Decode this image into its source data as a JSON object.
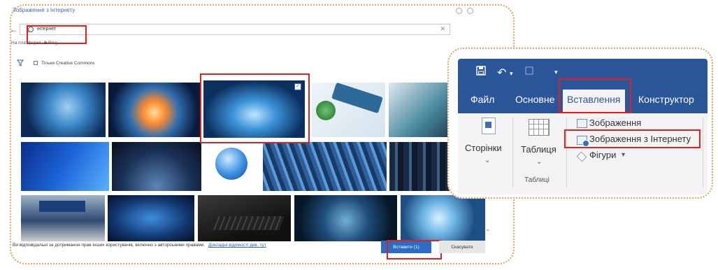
{
  "dialog": {
    "title": "Зображення з Інтернету",
    "search_value": "інтернет",
    "powered_by": "На платформі",
    "powered_brand": "Bing",
    "filter_label": "Тільки Creative Commons",
    "footer_text": "Ви відповідальні за дотримання прав інших користувачів, включно з авторськими правами.",
    "footer_link": "Докладні відомості див. тут",
    "insert_label": "Вставити (1)",
    "cancel_label": "Скасувати",
    "image_descriptions": [
      "laptop-globe",
      "earth-sparks",
      "earth-blue-selected",
      "internet-keyboard-hand",
      "network-icons-screen",
      "binary-globe-hand",
      "earth-night-network",
      "globe-hand",
      "server-cables",
      "data-center",
      "internet-banking-keyboard",
      "world-map-network",
      "gloved-hand-keyboard",
      "network-sphere",
      "digital-globe"
    ]
  },
  "ribbon": {
    "tabs": [
      "Файл",
      "Основне",
      "Вставлення",
      "Конструктор"
    ],
    "active_tab": "Вставлення",
    "pages_label": "Сторінки",
    "table_label": "Таблиця",
    "tables_group": "Таблиці",
    "pictures_label": "Зображення",
    "online_pictures_label": "Зображення з Інтернету",
    "shapes_label": "Фігури"
  },
  "colors": {
    "accent_blue": "#2b579a",
    "highlight_red": "#e0201f",
    "card_border": "#e8a35c"
  }
}
